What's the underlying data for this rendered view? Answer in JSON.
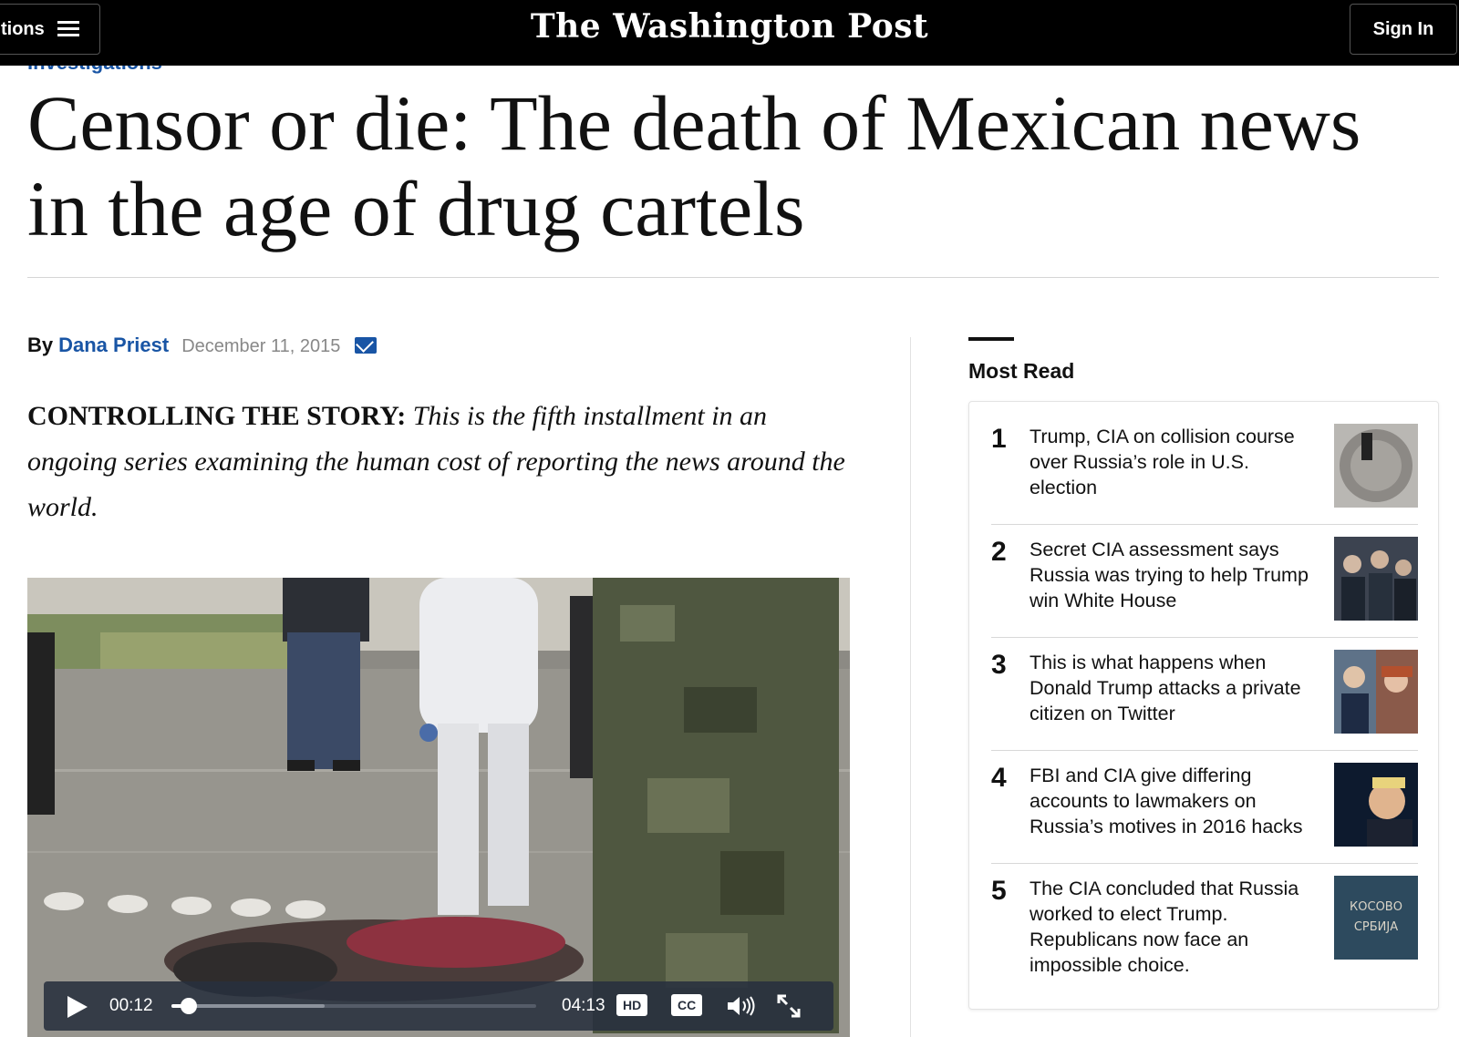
{
  "topbar": {
    "sections_label": "Sections",
    "sections_visible": "tions",
    "masthead": "The Washington Post",
    "signin_label": "Sign In"
  },
  "article": {
    "kicker": "Investigations",
    "headline": "Censor or die: The death of Mexican news in the age of drug cartels",
    "byline_prefix": "By",
    "author": "Dana Priest",
    "date": "December 11, 2015",
    "intro_lead": "CONTROLLING THE STORY:",
    "intro_rest": " This is the fifth installment in an ongoing series examining the human cost of reporting the news around the world."
  },
  "video": {
    "current_time": "00:12",
    "total_time": "04:13",
    "progress_fraction": 0.047,
    "buffer_fraction": 0.42,
    "hd_label": "HD",
    "cc_label": "CC"
  },
  "most_read": {
    "title": "Most Read",
    "items": [
      {
        "rank": "1",
        "headline": "Trump, CIA on collision course over Russia’s role in U.S. election",
        "thumb_icon": "cia-seal-photo"
      },
      {
        "rank": "2",
        "headline": "Secret CIA assessment says Russia was trying to help Trump win White House",
        "thumb_icon": "crowd-photo"
      },
      {
        "rank": "3",
        "headline": "This is what happens when Donald Trump attacks a private citizen on Twitter",
        "thumb_icon": "portraits-photo"
      },
      {
        "rank": "4",
        "headline": "FBI and CIA give differing accounts to lawmakers on Russia’s motives in 2016 hacks",
        "thumb_icon": "speaker-photo"
      },
      {
        "rank": "5",
        "headline": "The CIA concluded that Russia worked to elect Trump. Republicans now face an impossible choice.",
        "thumb_icon": "graffiti-photo",
        "thumb_text_1": "КОСОВО",
        "thumb_text_2": "СРБИЈА"
      }
    ]
  },
  "colors": {
    "link_blue": "#1955a5",
    "topbar_bg": "#000000"
  }
}
